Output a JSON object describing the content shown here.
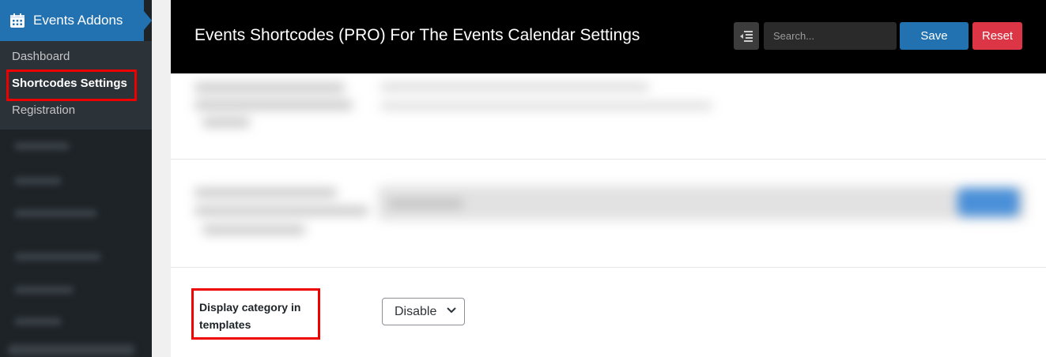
{
  "sidebar": {
    "menu_title": "Events Addons",
    "items": [
      {
        "label": "Dashboard"
      },
      {
        "label": "Shortcodes Settings",
        "active": true
      },
      {
        "label": "Registration"
      }
    ],
    "accent_color": "#2271b1"
  },
  "header": {
    "title": "Events Shortcodes (PRO) For The Events Calendar Settings",
    "search_placeholder": "Search...",
    "save_label": "Save",
    "reset_label": "Reset"
  },
  "settings": {
    "display_category": {
      "label": "Display category in templates",
      "value": "Disable"
    }
  },
  "highlight_color": "#e00000"
}
